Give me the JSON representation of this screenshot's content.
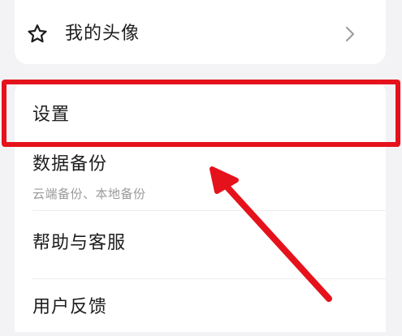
{
  "menu": {
    "avatar": {
      "label": "我的头像",
      "icon": "star-icon",
      "chevron": "chevron-right-icon"
    },
    "settings": {
      "label": "设置"
    },
    "backup": {
      "label": "数据备份",
      "sublabel": "云端备份、本地备份"
    },
    "help": {
      "label": "帮助与客服"
    },
    "feedback": {
      "label": "用户反馈"
    }
  },
  "annotation": {
    "highlight_color": "#e5121c",
    "arrow_icon": "arrow-pointer-icon"
  }
}
